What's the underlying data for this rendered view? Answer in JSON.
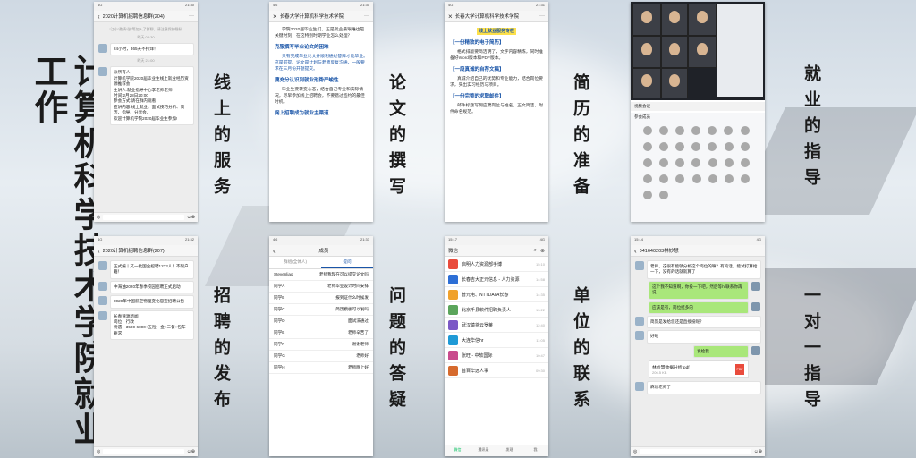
{
  "title": "计算机科学技术学院就业工作",
  "labels": {
    "online_service": "线上的服务",
    "paper_writing": "论文的撰写",
    "resume_prep": "简历的准备",
    "career_guidance": "就业的指导",
    "recruit_release": "招聘的发布",
    "qa": "问题的答疑",
    "employer_contact": "单位的联系",
    "one_on_one": "一对一指导"
  },
  "phone1": {
    "header": "2020计算机招聘信息群(204)",
    "notice": "“江小”邀请“张”等加入了群聊，请注意保护隐私",
    "msg1": "24小时，365天不打烊！",
    "msg2_lines": [
      "@所有人",
      "计算机学院2020届毕业生线上就业经历资源推荐会",
      "主讲人:就业指导中心李老师老师",
      "时间:2月28日20:00",
      "参会方式:请在群内观看",
      "宣讲内容:线上就业、面试技巧分析、简历、指导、分享会。",
      "欢迎计算机学院2020届毕业生参加!"
    ],
    "time1": "昨天 08:30",
    "time2": "昨天 21:00"
  },
  "phone2": {
    "header": "长春大学计算机科学技术学院",
    "intro": "学院2020届毕业生们，正是就业最艰难也是关键时刻，在这特别时期学业怎么处理？",
    "h1": "克服撰写毕业论文的困难",
    "p1": "只有完成毕业论文并顺利通过答辩才能毕业。这是前提。论文是计划与老师反复沟通，一般要求在三月份开题提交。",
    "h2": "要充分认识到就业形势严峻性",
    "p2": "毕业生要转变心态，结合自己专业和实际情况，尽早参加线上招聘会，不要错过签约的最佳时机。",
    "h3": "网上招聘成为就业主渠道"
  },
  "phone3": {
    "header": "长春大学计算机科学技术学院",
    "banner": "线上就业服务专栏",
    "h1": "【一份精致的电子简历】",
    "p1": "格式排版要简洁明了，文字内容精炼，同时准备好Word版本和PDF版本。",
    "h2": "【一段真诚的自荐文稿】",
    "p2": "真诚介绍自己的优势和专业能力，结合岗位要求，突出实习经历与项目。",
    "h3": "【一份完整的求职邮件】",
    "p3": "邮件标题写明应聘岗位与姓名，正文简洁，附件命名规范。"
  },
  "phone4": {
    "toolbar": "视频会议",
    "panel_title": "参会成员"
  },
  "phone5": {
    "header": "2020计算机招聘信息群(207)",
    "msg1": "正式编丨又一批国企招聘12??人！不限户籍！",
    "msg2": "中海油2020年春季校园招聘正式启动",
    "msg3": "2020年中国航空物理变化官宣招聘公告",
    "msg4_lines": [
      "长春速源新闻",
      "岗位：行政",
      "待遇：3500-6000+五险一金+三餐+包车",
      "要求："
    ]
  },
  "phone6": {
    "header": "成员",
    "tab1": "群组(全体人)",
    "tab2": "提问",
    "rows": [
      {
        "name": "Stevenliao",
        "msg": "老师我现在可以提交论文吗"
      },
      {
        "name": "同学A",
        "msg": "老师毕业设计时间安排"
      },
      {
        "name": "同学B",
        "msg": "报到证什么时候发"
      },
      {
        "name": "同学C",
        "msg": "简历模板可以发吗"
      },
      {
        "name": "同学D",
        "msg": "面试没通过"
      },
      {
        "name": "同学E",
        "msg": "老师辛苦了"
      },
      {
        "name": "同学F",
        "msg": "谢谢老师"
      },
      {
        "name": "同学G",
        "msg": "老师好"
      },
      {
        "name": "同学H",
        "msg": "老师晚上好"
      }
    ]
  },
  "phone7": {
    "header": "微信",
    "time": "15:17",
    "chats": [
      {
        "name": "启明人力资源部手博",
        "time": "15:10",
        "color": "#e94b3c"
      },
      {
        "name": "长春吉大正元信息 - 人力资源",
        "time": "14:58",
        "color": "#2d6fd6"
      },
      {
        "name": "普元电、NTTDATA长春",
        "time": "14:35",
        "color": "#f0a12b"
      },
      {
        "name": "北京千县软件招聘负责人",
        "time": "13:22",
        "color": "#5ba55b"
      },
      {
        "name": "武汉猿将云罗莱",
        "time": "12:40",
        "color": "#7b58c6"
      },
      {
        "name": "大连华信hr",
        "time": "11:05",
        "color": "#1f9ad6"
      },
      {
        "name": "张旺 - 中软国际",
        "time": "10:47",
        "color": "#c94b8d"
      },
      {
        "name": "首百华远人事",
        "time": "09:30",
        "color": "#d66a2d"
      }
    ],
    "tabs": [
      "微信",
      "通讯录",
      "发现",
      "我"
    ]
  },
  "phone8": {
    "time": "15:14",
    "header": "041640203林妙慧",
    "m1": "老师，这很有能够分析这个岗位的嘛？有的话，能试打算给一下，没有的话就就算了",
    "m2": "这个我不知道啊，你投一下吧，然后等hr联系你再说",
    "m3": "应该是有，岗位挺多的",
    "m4": "简历是发给您还是直接投呢？",
    "m5": "好哒",
    "m6": "发给我",
    "file_name": "林妙慧数据分析.pdf",
    "file_size": "206.5 KB",
    "file_badge": "PDF",
    "m7": "麻烦老师了"
  }
}
